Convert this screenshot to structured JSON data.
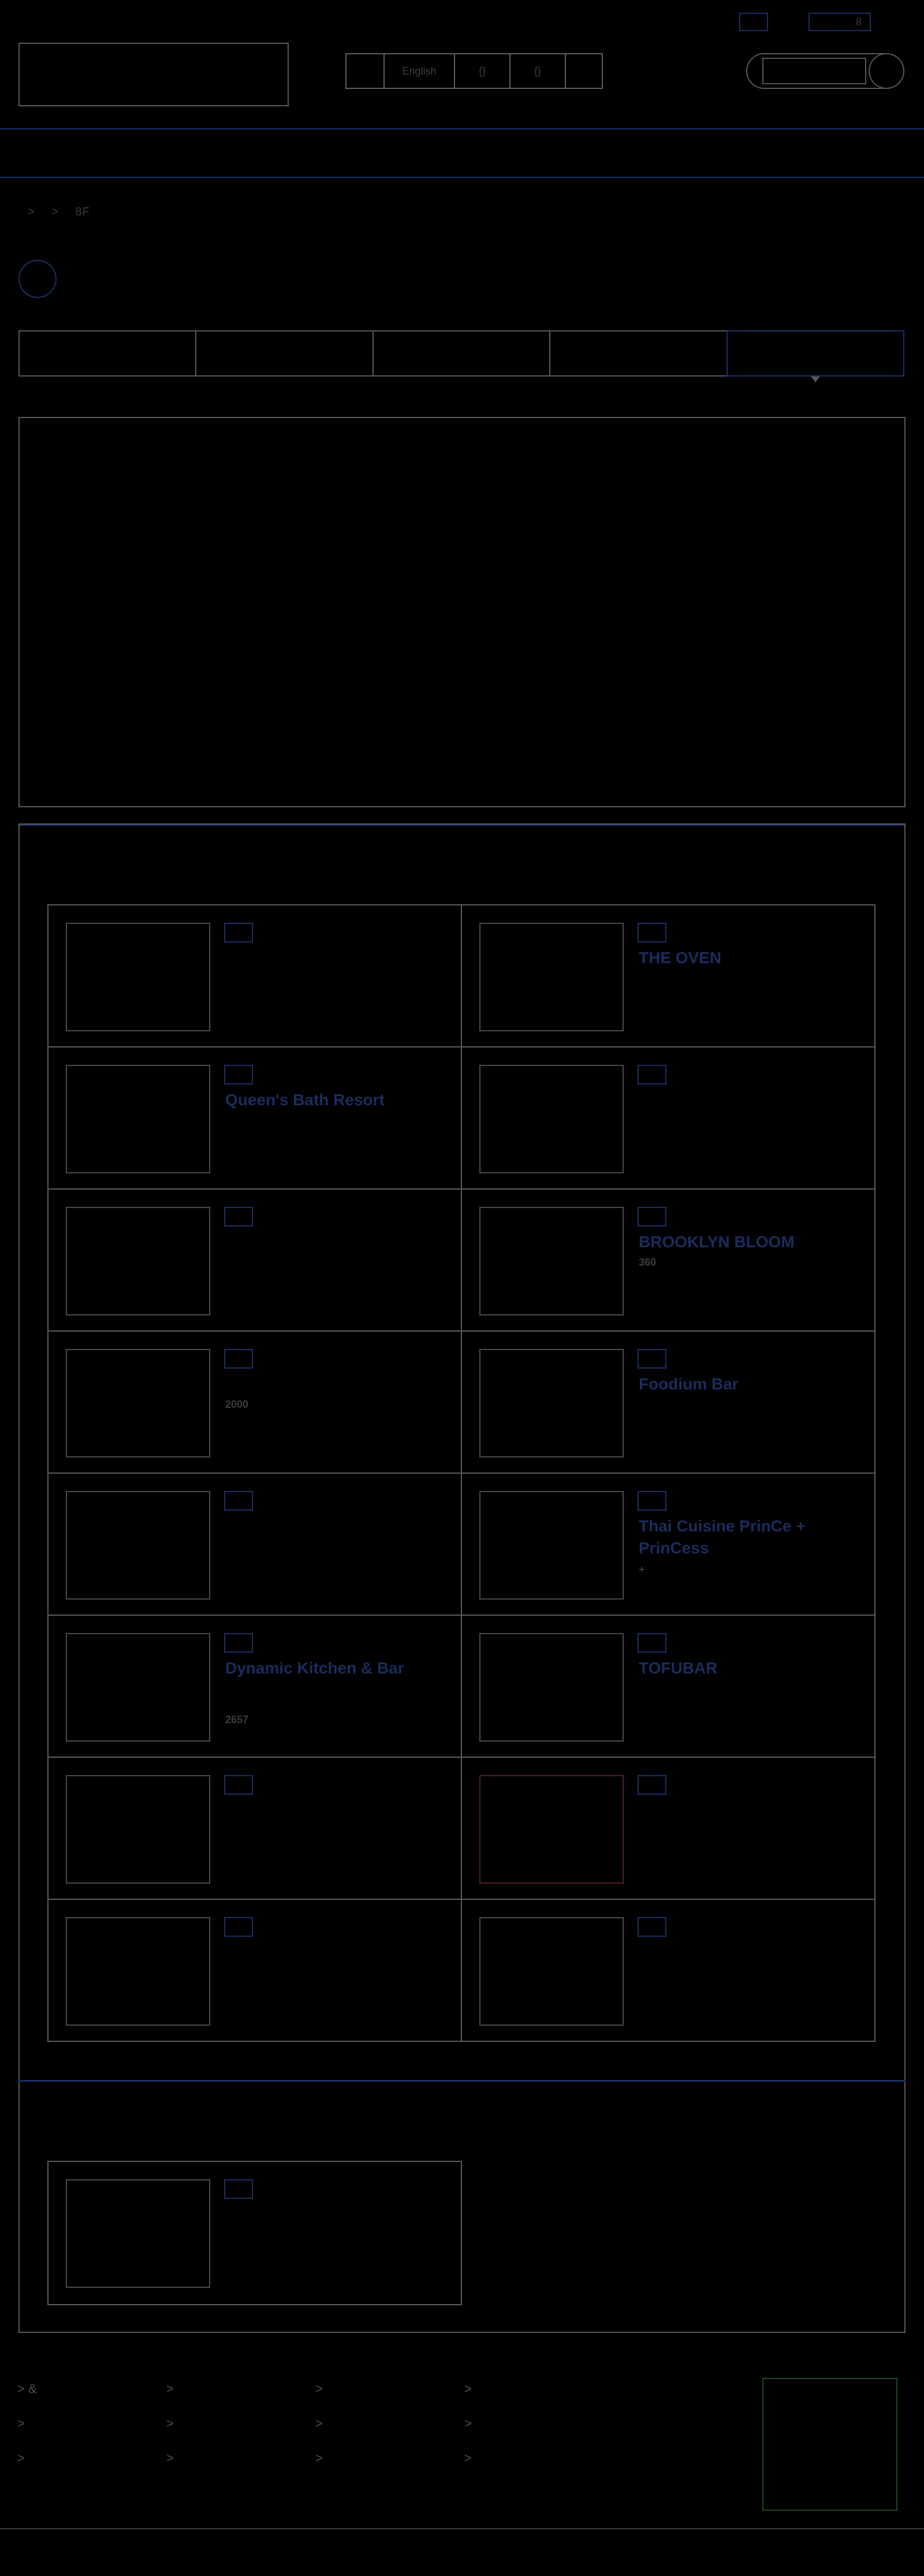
{
  "header": {
    "top_button_1": "",
    "top_button_2": "8",
    "language_bar": [
      "",
      "English",
      "{}",
      "{}",
      ""
    ],
    "search_placeholder": ""
  },
  "breadcrumb": [
    ">",
    ">",
    "8F"
  ],
  "tabs": [
    "",
    "",
    "",
    "",
    ""
  ],
  "restaurants": [
    {
      "title": "",
      "sub": ""
    },
    {
      "title": "THE OVEN",
      "sub": ""
    },
    {
      "title": "Queen's Bath Resort",
      "sub": ""
    },
    {
      "title": "",
      "sub": ""
    },
    {
      "title": "",
      "sub": ""
    },
    {
      "title": "BROOKLYN BLOOM",
      "sub": "360"
    },
    {
      "title": "",
      "sub": "2000"
    },
    {
      "title": "Foodium Bar",
      "sub": ""
    },
    {
      "title": "",
      "sub": ""
    },
    {
      "title": "Thai Cuisine PrinCe + PrinCess",
      "sub": "+"
    },
    {
      "title": "Dynamic Kitchen & Bar",
      "sub": "2657"
    },
    {
      "title": "TOFUBAR",
      "sub": ""
    },
    {
      "title": "",
      "sub": ""
    },
    {
      "title": "",
      "sub": ""
    },
    {
      "title": "",
      "sub": ""
    },
    {
      "title": "",
      "sub": ""
    }
  ],
  "footer": {
    "links": [
      ">  &",
      ">",
      ">",
      ">",
      ">",
      ">",
      ">",
      ">",
      ">",
      ">",
      ">",
      ">"
    ]
  },
  "colors": {
    "accent": "#1c2e63",
    "border": "#5a5a5a",
    "background": "#000000"
  }
}
